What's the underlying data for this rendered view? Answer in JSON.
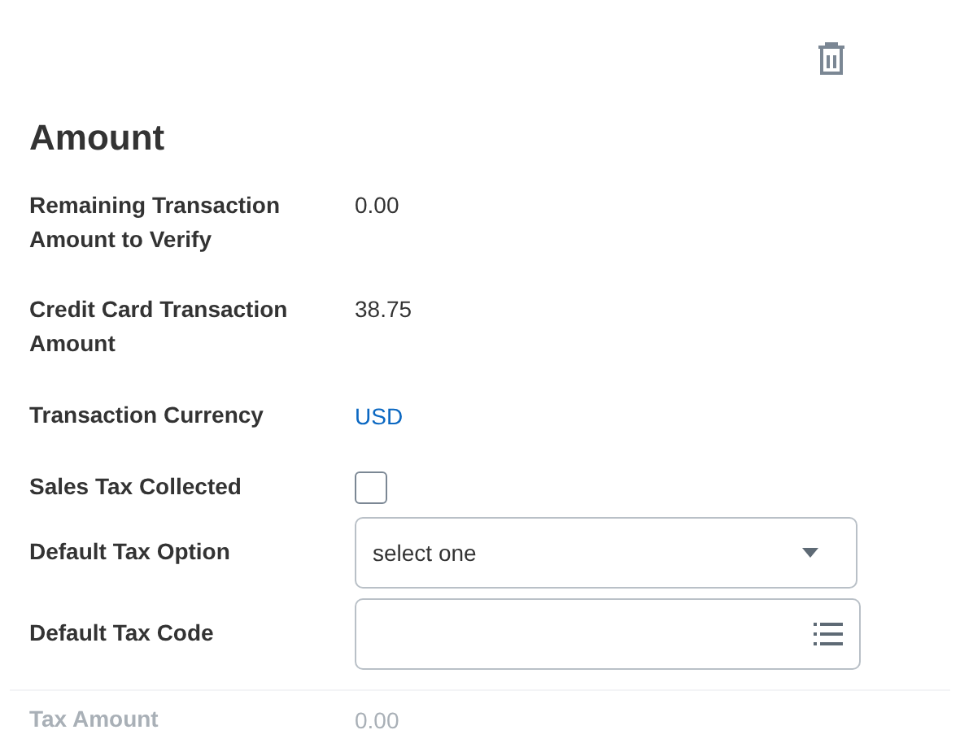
{
  "section": {
    "title": "Amount"
  },
  "fields": [
    {
      "kind": "text",
      "label": "Remaining Transaction Amount to Verify",
      "value": "0.00"
    },
    {
      "kind": "text",
      "label": "Credit Card Transaction Amount",
      "value": "38.75"
    },
    {
      "kind": "link",
      "label": "Transaction Currency",
      "value": "USD"
    },
    {
      "kind": "checkbox",
      "label": "Sales Tax Collected",
      "checked": false
    },
    {
      "kind": "select",
      "label": "Default Tax Option",
      "value": "select one"
    },
    {
      "kind": "lookup",
      "label": "Default Tax Code"
    }
  ],
  "next_section": {
    "faded": true,
    "fields": [
      {
        "label": "Tax Amount",
        "value": "0.00"
      }
    ]
  }
}
